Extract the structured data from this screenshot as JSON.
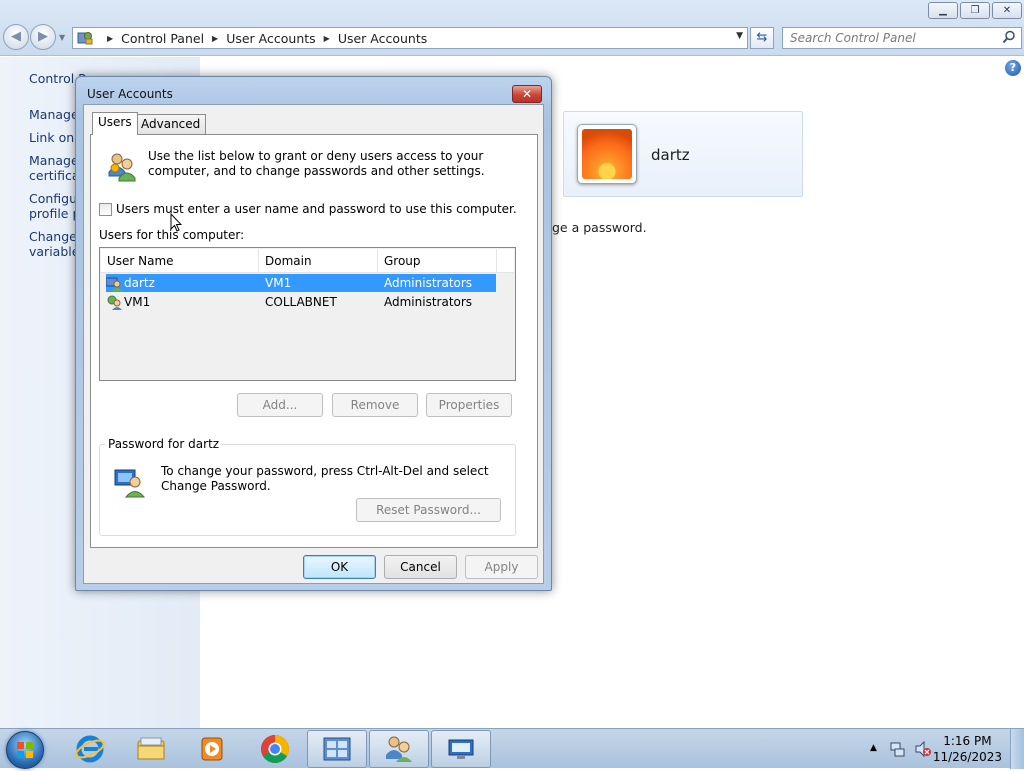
{
  "explorer": {
    "address": {
      "segments": [
        "Control Panel",
        "User Accounts",
        "User Accounts"
      ]
    },
    "search_placeholder": "Search Control Panel",
    "left_pane": {
      "links": [
        "Control P",
        "Manage",
        "Link onli",
        "Manage",
        "certificat",
        "Configu",
        "profile pr",
        "Change",
        "variables"
      ]
    },
    "user_tile": {
      "name": "dartz"
    },
    "background_text": "ge a password."
  },
  "dialog": {
    "title": "User Accounts",
    "close_symbol": "✕",
    "tabs": [
      "Users",
      "Advanced"
    ],
    "intro_text": "Use the list below to grant or deny users access to your computer, and to change passwords and other settings.",
    "checkbox_label": "Users must enter a user name and password to use this computer.",
    "checkbox_checked": false,
    "users_label": "Users for this computer:",
    "columns": [
      "User Name",
      "Domain",
      "Group"
    ],
    "rows": [
      {
        "user": "dartz",
        "domain": "VM1",
        "group": "Administrators",
        "selected": true
      },
      {
        "user": "VM1",
        "domain": "COLLABNET",
        "group": "Administrators",
        "selected": false
      }
    ],
    "buttons": {
      "add": "Add...",
      "remove": "Remove",
      "properties": "Properties",
      "reset_password": "Reset Password...",
      "ok": "OK",
      "cancel": "Cancel",
      "apply": "Apply"
    },
    "password_group": {
      "label": "Password for dartz",
      "text": "To change your password, press Ctrl-Alt-Del and select Change Password."
    }
  },
  "taskbar": {
    "time": "1:16 PM",
    "date": "11/26/2023",
    "tray_arrow": "▲"
  },
  "colors": {
    "selection": "#3399ff",
    "link": "#1a3a6e",
    "dialog_frame": "#a9c3e3"
  }
}
